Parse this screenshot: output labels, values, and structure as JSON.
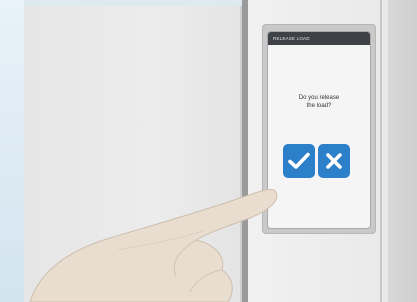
{
  "device": {
    "status_title": "RELEASE LOAD",
    "status_right": "",
    "prompt_line1": "Do you release",
    "prompt_line2": "the load?"
  },
  "colors": {
    "button_blue": "#2c7fc9",
    "status_bar": "#3e4146"
  },
  "icons": {
    "confirm": "checkmark-icon",
    "cancel": "close-x-icon"
  }
}
